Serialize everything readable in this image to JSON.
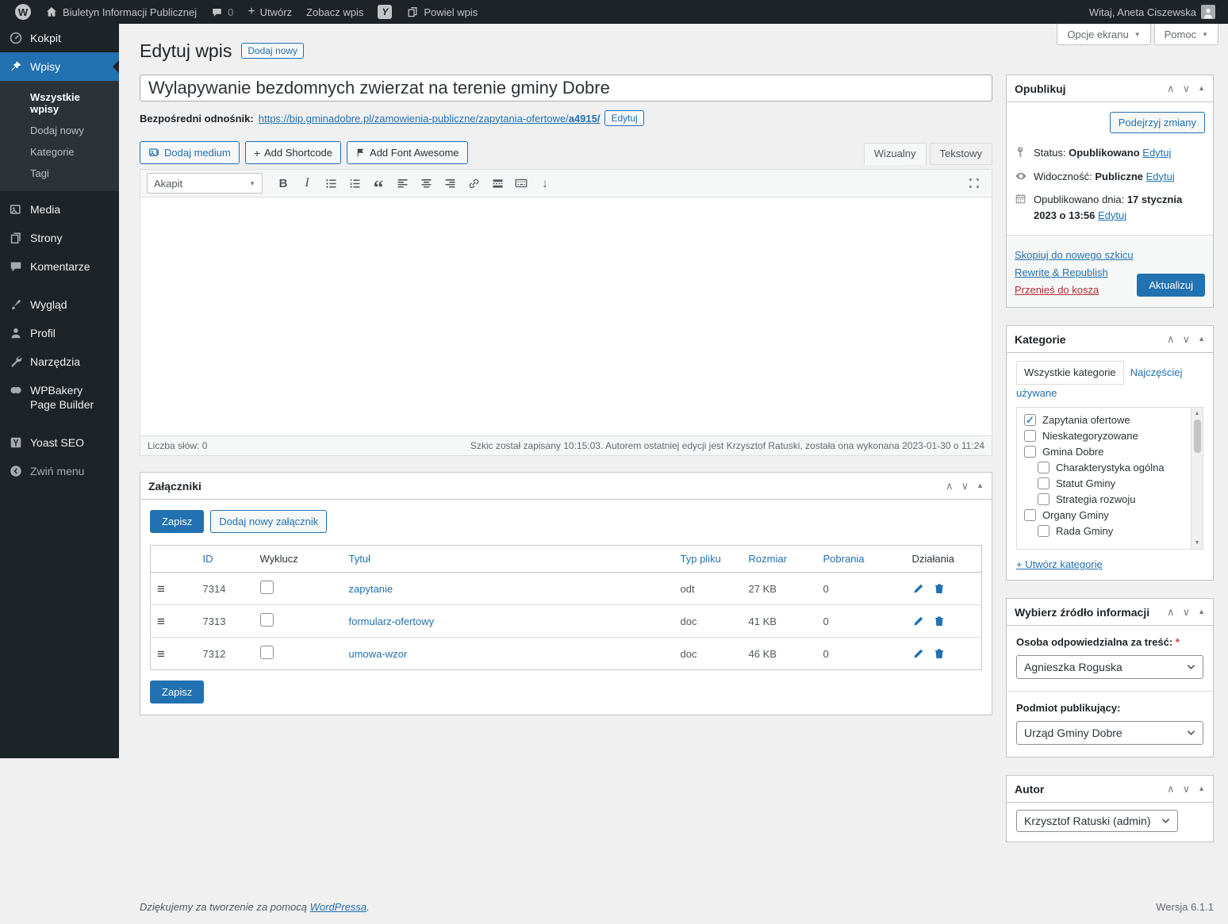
{
  "admin_bar": {
    "site_name": "Biuletyn Informacji Publicznej",
    "comments_count": "0",
    "new_button": "Utwórz",
    "view_post": "Zobacz wpis",
    "duplicate_post": "Powiel wpis",
    "greeting": "Witaj, Aneta Ciszewska"
  },
  "sidebar": {
    "items": [
      {
        "label": "Kokpit"
      },
      {
        "label": "Wpisy"
      },
      {
        "label": "Media"
      },
      {
        "label": "Strony"
      },
      {
        "label": "Komentarze"
      },
      {
        "label": "Wygląd"
      },
      {
        "label": "Profil"
      },
      {
        "label": "Narzędzia"
      },
      {
        "label": "WPBakery Page Builder"
      },
      {
        "label": "Yoast SEO"
      },
      {
        "label": "Zwiń menu"
      }
    ],
    "wpisy_submenu": [
      "Wszystkie wpisy",
      "Dodaj nowy",
      "Kategorie",
      "Tagi"
    ]
  },
  "screen_meta": {
    "screen_options": "Opcje ekranu",
    "help": "Pomoc"
  },
  "page": {
    "title": "Edytuj wpis",
    "add_new": "Dodaj nowy"
  },
  "post": {
    "title": "Wylapywanie bezdomnych zwierzat na terenie gminy Dobre"
  },
  "permalink": {
    "label": "Bezpośredni odnośnik:",
    "url_base": "https://bip.gminadobre.pl/zamowienia-publiczne/zapytania-ofertowe/",
    "slug": "a4915/",
    "edit_button": "Edytuj"
  },
  "editor": {
    "media_button": "Dodaj medium",
    "shortcode_button": "Add Shortcode",
    "fontawesome_button": "Add Font Awesome",
    "tab_visual": "Wizualny",
    "tab_text": "Tekstowy",
    "format_select": "Akapit",
    "word_count": "Liczba słów: 0",
    "save_notice": "Szkic został zapisany 10:15:03. Autorem ostatniej edycji jest Krzysztof Ratuski, została ona wykonana 2023-01-30 o 11:24"
  },
  "attachments": {
    "title": "Załączniki",
    "save_button": "Zapisz",
    "add_button": "Dodaj nowy załącznik",
    "columns": [
      "ID",
      "Wyklucz",
      "Tytuł",
      "Typ pliku",
      "Rozmiar",
      "Pobrania",
      "Działania"
    ],
    "rows": [
      {
        "id": "7314",
        "title": "zapytanie",
        "type": "odt",
        "size": "27 KB",
        "downloads": "0"
      },
      {
        "id": "7313",
        "title": "formularz-ofertowy",
        "type": "doc",
        "size": "41 KB",
        "downloads": "0"
      },
      {
        "id": "7312",
        "title": "umowa-wzor",
        "type": "doc",
        "size": "46 KB",
        "downloads": "0"
      }
    ]
  },
  "publish": {
    "title": "Opublikuj",
    "preview_button": "Podejrzyj zmiany",
    "status_label": "Status:",
    "status_value": "Opublikowano",
    "edit_link": "Edytuj",
    "visibility_label": "Widoczność:",
    "visibility_value": "Publiczne",
    "published_label": "Opublikowano dnia:",
    "published_value": "17 stycznia 2023 o 13:56",
    "copy_draft": "Skopiuj do nowego szkicu",
    "rewrite_republish": "Rewrite & Republish",
    "trash_link": "Przenieś do kosza",
    "update_button": "Aktualizuj"
  },
  "categories": {
    "title": "Kategorie",
    "tab_all": "Wszystkie kategorie",
    "tab_most_used": "Najczęściej używane",
    "items": [
      {
        "label": "Zapytania ofertowe",
        "checked": true,
        "indent": 0
      },
      {
        "label": "Nieskategoryzowane",
        "checked": false,
        "indent": 0
      },
      {
        "label": "Gmina Dobre",
        "checked": false,
        "indent": 0
      },
      {
        "label": "Charakterystyka ogólna",
        "checked": false,
        "indent": 1
      },
      {
        "label": "Statut Gminy",
        "checked": false,
        "indent": 1
      },
      {
        "label": "Strategia rozwoju",
        "checked": false,
        "indent": 1
      },
      {
        "label": "Organy Gminy",
        "checked": false,
        "indent": 0
      },
      {
        "label": "Rada Gminy",
        "checked": false,
        "indent": 1
      }
    ],
    "add_link": "+ Utwórz kategorię"
  },
  "source": {
    "title": "Wybierz źródło informacji",
    "person_label": "Osoba odpowiedzialna za treść:",
    "required_mark": "*",
    "person_value": "Agnieszka Roguska",
    "publisher_label": "Podmiot publikujący:",
    "publisher_value": "Urząd Gminy Dobre"
  },
  "author_box": {
    "title": "Autor",
    "value": "Krzysztof Ratuski (admin)"
  },
  "footer": {
    "thanks_prefix": "Dziękujemy za tworzenie za pomocą",
    "thanks_link": "WordPressa",
    "thanks_suffix": ".",
    "version": "Wersja 6.1.1"
  },
  "icons": {
    "drag_handle": "≡",
    "chevron_up": "∧",
    "chevron_down": "∨",
    "toggle_open": "▲",
    "dropdown_arrow": "▼",
    "scroll_up": "▲",
    "scroll_down": "▼",
    "checkmark": "✓",
    "down_arrow": "↓",
    "blockquote": "“",
    "plus": "+",
    "wp_logo_letter": "W",
    "yoast_letter": "Y"
  }
}
